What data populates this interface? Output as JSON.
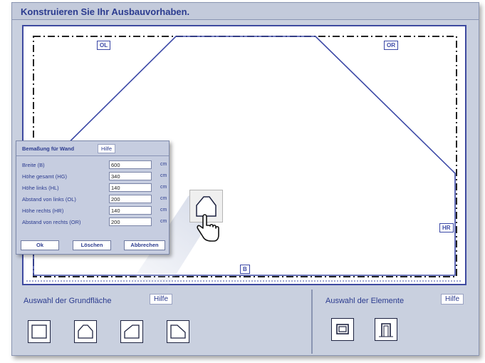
{
  "window": {
    "title": "Konstruieren Sie Ihr Ausbauvorhaben."
  },
  "canvas": {
    "labels": {
      "ol": "OL",
      "or": "OR",
      "hr": "HR",
      "b": "B"
    }
  },
  "dialog": {
    "title": "Bemaßung für Wand",
    "help": "Hilfe",
    "fields": [
      {
        "label": "Breite (B)",
        "value": "600",
        "unit": "cm"
      },
      {
        "label": "Höhe gesamt (HG)",
        "value": "340",
        "unit": "cm"
      },
      {
        "label": "Höhe links (HL)",
        "value": "140",
        "unit": "cm"
      },
      {
        "label": "Abstand von links (OL)",
        "value": "200",
        "unit": "cm"
      },
      {
        "label": "Höhe rechts (HR)",
        "value": "140",
        "unit": "cm"
      },
      {
        "label": "Abstand von rechts (OR)",
        "value": "200",
        "unit": "cm"
      }
    ],
    "buttons": {
      "ok": "Ok",
      "delete": "Löschen",
      "cancel": "Abbrechen"
    }
  },
  "floor_selection": {
    "title": "Auswahl der Grundfläche",
    "help": "Hilfe",
    "shapes": [
      "rectangle-shape-icon",
      "pentagon-roof-shape-icon",
      "slanted-left-shape-icon",
      "slanted-right-shape-icon"
    ]
  },
  "element_selection": {
    "title": "Auswahl der Elemente",
    "help": "Hilfe",
    "elements": [
      "window-element-icon",
      "door-element-icon"
    ]
  },
  "colors": {
    "accent": "#2b3b8f",
    "line": "#3b48a6",
    "panel": "#c9d0df"
  }
}
